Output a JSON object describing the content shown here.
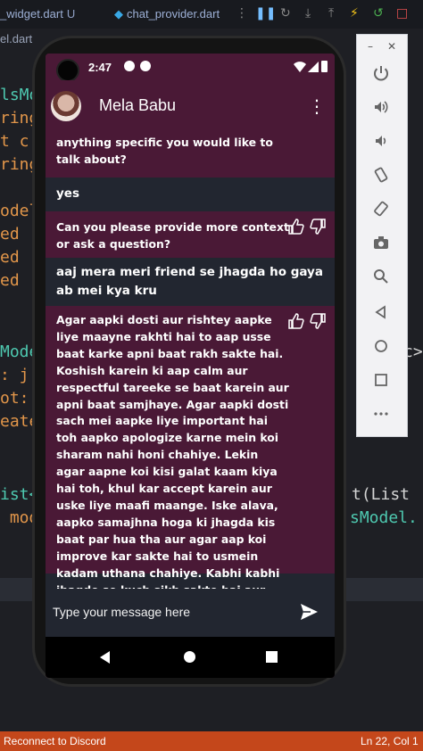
{
  "ide": {
    "tabs": [
      {
        "label": "_widget.dart",
        "badge": "U"
      },
      {
        "label": "chat_provider.dart",
        "badge": ""
      }
    ],
    "breadcrumb": "el.dart",
    "code_lines": [
      {
        "text": "lsMo",
        "color": "#4ec9b0"
      },
      {
        "text": "ring",
        "color": "#e2964a"
      },
      {
        "text": "t c",
        "color": "#e2964a"
      },
      {
        "text": "ring",
        "color": "#e2964a"
      },
      {
        "text": "odel",
        "color": "#e2964a"
      },
      {
        "text": "ed",
        "color": "#e2964a"
      },
      {
        "text": "ed",
        "color": "#e2964a"
      },
      {
        "text": "ed",
        "color": "#e2964a"
      },
      {
        "text": "Mode",
        "color": "#4ec9b0"
      },
      {
        "text": ": j",
        "color": "#e2964a"
      },
      {
        "text": "ot:",
        "color": "#e2964a"
      },
      {
        "text": "eate",
        "color": "#e2964a"
      },
      {
        "text": "ist<",
        "color": "#4ec9b0"
      },
      {
        "text": " mod",
        "color": "#e2964a"
      }
    ],
    "code_right": [
      "c>",
      "t(List",
      "sModel."
    ],
    "status_left": "Reconnect to Discord",
    "status_right": "Ln 22, Col 1"
  },
  "phone": {
    "time": "2:47",
    "contact_name": "Mela Babu",
    "messages": [
      {
        "role": "bot",
        "text": "anything specific you would like to talk about?",
        "feedback": false
      },
      {
        "role": "user",
        "text": "yes"
      },
      {
        "role": "bot",
        "text": "Can you please provide more context or ask a question?",
        "feedback": true
      },
      {
        "role": "user",
        "text": "aaj mera meri friend se jhagda ho gaya ab mei kya kru"
      },
      {
        "role": "bot",
        "text": "Agar aapki dosti aur rishtey aapke liye maayne rakhti hai to aap usse baat karke apni baat rakh sakte hai. Koshish karein ki aap calm aur respectful tareeke se baat karein aur apni baat samjhaye. Agar aapki dosti sach mei aapke liye important hai toh aapko apologize karne mein koi sharam nahi honi chahiye. Lekin agar aapne koi kisi galat kaam kiya hai toh, khul kar accept karein aur uske liye maafi maange. Iske alava, aapko samajhna hoga ki jhagda kis baat par hua tha aur agar aap koi improve kar sakte hai to usmein kadam uthana chahiye. Kabhi kabhi jhagde se kuch sikh sakte hai aur apni dosti ko aur bhi strong bana sakte hai.",
        "feedback": true
      }
    ],
    "input_placeholder": "Type your message here"
  },
  "colors": {
    "bot_bubble": "#4a1936",
    "chat_bg": "#222630",
    "status_bar": "#c4471b"
  }
}
